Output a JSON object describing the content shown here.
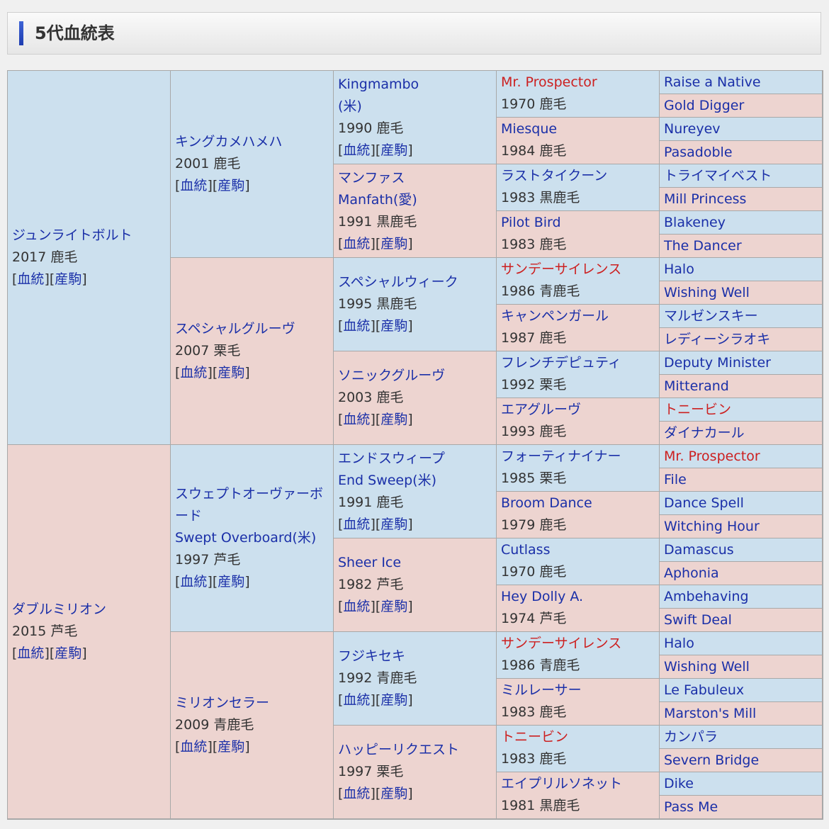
{
  "header": {
    "title": "5代血統表"
  },
  "links": {
    "pedigree": "血統",
    "offspring": "産駒",
    "open": "[",
    "close": "]"
  },
  "gen1": [
    {
      "name": "ジュンライトボルト",
      "year": "2017",
      "color": "鹿毛",
      "sex": "m"
    },
    {
      "name": "ダブルミリオン",
      "year": "2015",
      "color": "芦毛",
      "sex": "f"
    }
  ],
  "gen2": [
    {
      "name": "キングカメハメハ",
      "year": "2001",
      "color": "鹿毛",
      "sex": "m"
    },
    {
      "name": "スペシャルグルーヴ",
      "year": "2007",
      "color": "栗毛",
      "sex": "f"
    },
    {
      "name": "スウェプトオーヴァーボード",
      "name_en": "Swept Overboard(米)",
      "year": "1997",
      "color": "芦毛",
      "sex": "m"
    },
    {
      "name": "ミリオンセラー",
      "year": "2009",
      "color": "青鹿毛",
      "sex": "f"
    }
  ],
  "gen3": [
    {
      "name": "Kingmambo",
      "name_en": "(米)",
      "year": "1990",
      "color": "鹿毛",
      "sex": "m"
    },
    {
      "name": "マンファス",
      "name_en": "Manfath(愛)",
      "year": "1991",
      "color": "黒鹿毛",
      "sex": "f"
    },
    {
      "name": "スペシャルウィーク",
      "year": "1995",
      "color": "黒鹿毛",
      "sex": "m"
    },
    {
      "name": "ソニックグルーヴ",
      "year": "2003",
      "color": "鹿毛",
      "sex": "f"
    },
    {
      "name": "エンドスウィープ",
      "name_en": "End Sweep(米)",
      "year": "1991",
      "color": "鹿毛",
      "sex": "m"
    },
    {
      "name": "Sheer Ice",
      "year": "1982",
      "color": "芦毛",
      "sex": "f"
    },
    {
      "name": "フジキセキ",
      "year": "1992",
      "color": "青鹿毛",
      "sex": "m"
    },
    {
      "name": "ハッピーリクエスト",
      "year": "1997",
      "color": "栗毛",
      "sex": "f"
    }
  ],
  "gen4": [
    {
      "name": "Mr. Prospector",
      "year": "1970",
      "color": "鹿毛",
      "sex": "m",
      "red": true
    },
    {
      "name": "Miesque",
      "year": "1984",
      "color": "鹿毛",
      "sex": "f"
    },
    {
      "name": "ラストタイクーン",
      "year": "1983",
      "color": "黒鹿毛",
      "sex": "m"
    },
    {
      "name": "Pilot Bird",
      "year": "1983",
      "color": "鹿毛",
      "sex": "f"
    },
    {
      "name": "サンデーサイレンス",
      "year": "1986",
      "color": "青鹿毛",
      "sex": "m",
      "red": true
    },
    {
      "name": "キャンペンガール",
      "year": "1987",
      "color": "鹿毛",
      "sex": "f"
    },
    {
      "name": "フレンチデピュティ",
      "year": "1992",
      "color": "栗毛",
      "sex": "m"
    },
    {
      "name": "エアグルーヴ",
      "year": "1993",
      "color": "鹿毛",
      "sex": "f"
    },
    {
      "name": "フォーティナイナー",
      "year": "1985",
      "color": "栗毛",
      "sex": "m"
    },
    {
      "name": "Broom Dance",
      "year": "1979",
      "color": "鹿毛",
      "sex": "f"
    },
    {
      "name": "Cutlass",
      "year": "1970",
      "color": "鹿毛",
      "sex": "m"
    },
    {
      "name": "Hey Dolly A.",
      "year": "1974",
      "color": "芦毛",
      "sex": "f"
    },
    {
      "name": "サンデーサイレンス",
      "year": "1986",
      "color": "青鹿毛",
      "sex": "m",
      "red": true
    },
    {
      "name": "ミルレーサー",
      "year": "1983",
      "color": "鹿毛",
      "sex": "f"
    },
    {
      "name": "トニービン",
      "year": "1983",
      "color": "鹿毛",
      "sex": "m",
      "red": true
    },
    {
      "name": "エイプリルソネット",
      "year": "1981",
      "color": "黒鹿毛",
      "sex": "f"
    }
  ],
  "gen5": [
    {
      "name": "Raise a Native",
      "sex": "m"
    },
    {
      "name": "Gold Digger",
      "sex": "f"
    },
    {
      "name": "Nureyev",
      "sex": "m"
    },
    {
      "name": "Pasadoble",
      "sex": "f"
    },
    {
      "name": "トライマイベスト",
      "sex": "m"
    },
    {
      "name": "Mill Princess",
      "sex": "f"
    },
    {
      "name": "Blakeney",
      "sex": "m"
    },
    {
      "name": "The Dancer",
      "sex": "f"
    },
    {
      "name": "Halo",
      "sex": "m"
    },
    {
      "name": "Wishing Well",
      "sex": "f"
    },
    {
      "name": "マルゼンスキー",
      "sex": "m"
    },
    {
      "name": "レディーシラオキ",
      "sex": "f"
    },
    {
      "name": "Deputy Minister",
      "sex": "m"
    },
    {
      "name": "Mitterand",
      "sex": "f"
    },
    {
      "name": "トニービン",
      "sex": "m",
      "red": true
    },
    {
      "name": "ダイナカール",
      "sex": "f"
    },
    {
      "name": "Mr. Prospector",
      "sex": "m",
      "red": true
    },
    {
      "name": "File",
      "sex": "f"
    },
    {
      "name": "Dance Spell",
      "sex": "m"
    },
    {
      "name": "Witching Hour",
      "sex": "f"
    },
    {
      "name": "Damascus",
      "sex": "m"
    },
    {
      "name": "Aphonia",
      "sex": "f"
    },
    {
      "name": "Ambehaving",
      "sex": "m"
    },
    {
      "name": "Swift Deal",
      "sex": "f"
    },
    {
      "name": "Halo",
      "sex": "m"
    },
    {
      "name": "Wishing Well",
      "sex": "f"
    },
    {
      "name": "Le Fabuleux",
      "sex": "m"
    },
    {
      "name": "Marston's Mill",
      "sex": "f"
    },
    {
      "name": "カンパラ",
      "sex": "m"
    },
    {
      "name": "Severn Bridge",
      "sex": "f"
    },
    {
      "name": "Dike",
      "sex": "m"
    },
    {
      "name": "Pass Me",
      "sex": "f"
    }
  ],
  "colors": {
    "male_bg": "#cce0ee",
    "female_bg": "#edd4d0",
    "link": "#1a2fa8",
    "highlight": "#cc2020"
  }
}
